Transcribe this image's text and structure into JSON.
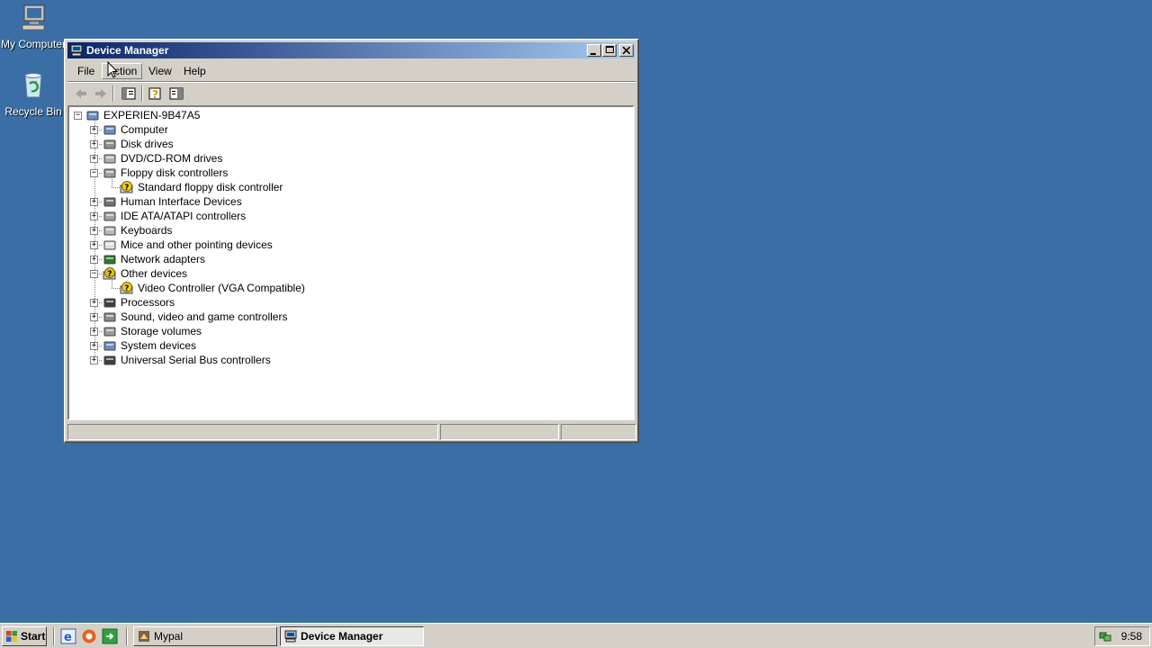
{
  "desktop": {
    "icons": [
      {
        "label": "My Computer",
        "icon": "my-computer-icon"
      },
      {
        "label": "Recycle Bin",
        "icon": "recycle-bin-icon"
      }
    ]
  },
  "window": {
    "title": "Device Manager",
    "menu": [
      "File",
      "Action",
      "View",
      "Help"
    ],
    "toolbar": [
      "back",
      "forward",
      "show-hide-console-tree",
      "help",
      "properties"
    ],
    "tree": {
      "root": "EXPERIEN-9B47A5",
      "items": [
        {
          "label": "Computer",
          "expanded": false,
          "icon": "computer-icon"
        },
        {
          "label": "Disk drives",
          "expanded": false,
          "icon": "disk-drive-icon"
        },
        {
          "label": "DVD/CD-ROM drives",
          "expanded": false,
          "icon": "cdrom-icon"
        },
        {
          "label": "Floppy disk controllers",
          "expanded": true,
          "icon": "floppy-controller-icon",
          "children": [
            {
              "label": "Standard floppy disk controller",
              "icon": "warning-device-icon"
            }
          ]
        },
        {
          "label": "Human Interface Devices",
          "expanded": false,
          "icon": "hid-icon"
        },
        {
          "label": "IDE ATA/ATAPI controllers",
          "expanded": false,
          "icon": "ide-controller-icon"
        },
        {
          "label": "Keyboards",
          "expanded": false,
          "icon": "keyboard-icon"
        },
        {
          "label": "Mice and other pointing devices",
          "expanded": false,
          "icon": "mouse-icon"
        },
        {
          "label": "Network adapters",
          "expanded": false,
          "icon": "network-adapter-icon"
        },
        {
          "label": "Other devices",
          "expanded": true,
          "icon": "unknown-device-icon",
          "children": [
            {
              "label": "Video Controller (VGA Compatible)",
              "icon": "warning-device-icon"
            }
          ]
        },
        {
          "label": "Processors",
          "expanded": false,
          "icon": "processor-icon"
        },
        {
          "label": "Sound, video and game controllers",
          "expanded": false,
          "icon": "sound-icon"
        },
        {
          "label": "Storage volumes",
          "expanded": false,
          "icon": "storage-volume-icon"
        },
        {
          "label": "System devices",
          "expanded": false,
          "icon": "system-device-icon"
        },
        {
          "label": "Universal Serial Bus controllers",
          "expanded": false,
          "icon": "usb-icon"
        }
      ]
    }
  },
  "taskbar": {
    "start_label": "Start",
    "tasks": [
      {
        "label": "Mypal",
        "active": false
      },
      {
        "label": "Device Manager",
        "active": true
      }
    ],
    "clock": "9:58"
  },
  "colors": {
    "desktop": "#3a6ea5",
    "title_active": "#0a246a",
    "chrome": "#d4d0c8"
  }
}
